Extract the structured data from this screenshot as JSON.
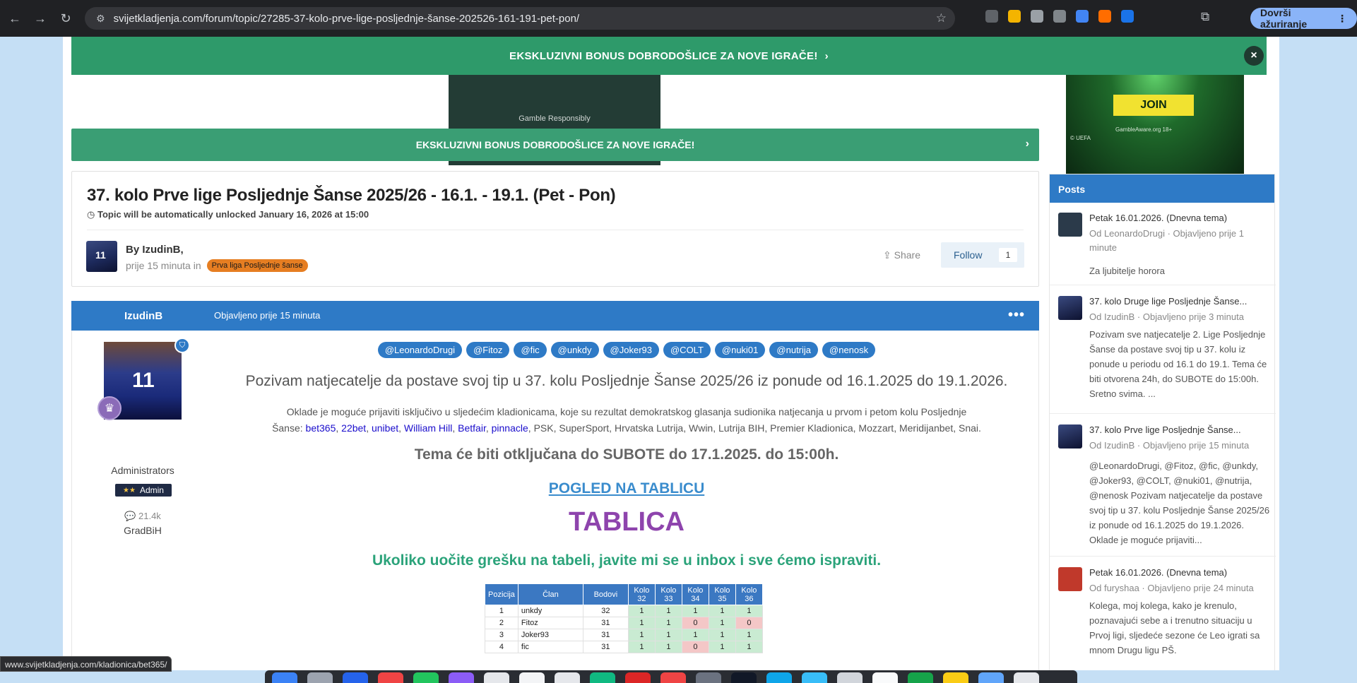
{
  "browser": {
    "url": "svijetkladjenja.com/forum/topic/27285-37-kolo-prve-lige-posljednje-šanse-202526-161-191-pet-pon/",
    "update_label": "Dovrši ažuriranje",
    "status_url": "www.svijetkladjenja.com/kladionica/bet365/"
  },
  "banner": {
    "text": "EKSKLUZIVNI BONUS DOBRODOŠLICE ZA NOVE IGRAČE!",
    "close": "×"
  },
  "ad_left": {
    "text": "Gamble Responsibly"
  },
  "ad_right": {
    "join": "JOIN",
    "ga": "GambleAware.org  18+",
    "uefa": "© UEFA"
  },
  "bonus_bar": {
    "text": "EKSKLUZIVNI BONUS DOBRODOŠLICE ZA NOVE IGRAČE!"
  },
  "topic": {
    "title": "37. kolo Prve lige Posljednje Šanse 2025/26 - 16.1. - 19.1. (Pet - Pon)",
    "lock_note": "Topic will be automatically unlocked January 16, 2026 at 15:00",
    "by": "By IzudinB,",
    "time": "prije 15 minuta in",
    "category": "Prva liga Posljednje šanse",
    "share": "Share",
    "follow": "Follow",
    "follow_count": "1"
  },
  "post": {
    "author": "IzudinB",
    "time": "Objavljeno prije 15 minuta",
    "group": "Administrators",
    "badge": "Admin",
    "post_count": "21.4k",
    "location": "GradBiH",
    "mentions": [
      "@LeonardoDrugi",
      "@Fitoz",
      "@fic",
      "@unkdy",
      "@Joker93",
      "@COLT",
      "@nuki01",
      "@nutrija",
      "@nenosk"
    ],
    "invite": "Pozivam natjecatelje da postave svoj tip u 37. kolu Posljednje Šanse 2025/26 iz ponude od 16.1.2025 do 19.1.2026.",
    "oklade_prefix": "Oklade je moguće prijaviti isključivo u sljedećim kladionicama, koje su rezultat demokratskog glasanja sudionika natjecanja u prvom i petom kolu Posljednje Šanse:",
    "oklade_links": [
      "bet365",
      "22bet",
      "unibet",
      "William Hill",
      "Betfair",
      "pinnacle"
    ],
    "oklade_suffix": "PSK, SuperSport, Hrvatska Lutrija, Wwin, Lutrija BIH, Premier Kladionica, Mozzart, Meridijanbet, Snai.",
    "tema": "Tema će biti otključana do SUBOTE do 17.1.2025. do 15:00h.",
    "pogled": "POGLED NA TABLICU",
    "tablica": "TABLICA",
    "greska": "Ukoliko uočite grešku na tabeli, javite mi se u inbox i sve ćemo ispraviti."
  },
  "table": {
    "headers": [
      "Pozicija",
      "Član",
      "Bodovi",
      "Kolo 32",
      "Kolo 33",
      "Kolo 34",
      "Kolo 35",
      "Kolo 36"
    ],
    "rows": [
      [
        "1",
        "unkdy",
        "32",
        "1",
        "1",
        "1",
        "1",
        "1"
      ],
      [
        "2",
        "Fitoz",
        "31",
        "1",
        "1",
        "0",
        "1",
        "0"
      ],
      [
        "3",
        "Joker93",
        "31",
        "1",
        "1",
        "1",
        "1",
        "1"
      ],
      [
        "4",
        "fic",
        "31",
        "1",
        "1",
        "0",
        "1",
        "1"
      ]
    ]
  },
  "sidebar": {
    "title": "Posts",
    "items": [
      {
        "title": "Petak 16.01.2026. (Dnevna tema)",
        "meta": "Od LeonardoDrugi · Objavljeno prije 1 minute",
        "snippet": "Za ljubitelje horora"
      },
      {
        "title": "37. kolo Druge lige Posljednje Šanse...",
        "meta": "Od IzudinB · Objavljeno prije 3 minuta",
        "snippet": "Pozivam sve natjecatelje 2. Lige Posljednje Šanse da postave svoj tip u 37. kolu iz ponude u periodu od 16.1 do 19.1. Tema će biti otvorena 24h, do SUBOTE do 15:00h. Sretno svima. ..."
      },
      {
        "title": "37. kolo Prve lige Posljednje Šanse...",
        "meta": "Od IzudinB · Objavljeno prije 15 minuta",
        "snippet": "@LeonardoDrugi, @Fitoz, @fic, @unkdy, @Joker93, @COLT, @nuki01, @nutrija, @nenosk Pozivam natjecatelje da postave svoj tip u 37. kolu Posljednje Šanse 2025/26 iz ponude od 16.1.2025 do 19.1.2026. Oklade je moguće prijaviti..."
      },
      {
        "title": "Petak 16.01.2026. (Dnevna tema)",
        "meta": "Od furyshaa · Objavljeno prije 24 minuta",
        "snippet": "Kolega, moj kolega, kako je krenulo, poznavajući sebe a i trenutno situaciju u Prvoj ligi, sljedeće sezone će Leo igrati sa mnom Drugu ligu PŠ."
      }
    ]
  }
}
